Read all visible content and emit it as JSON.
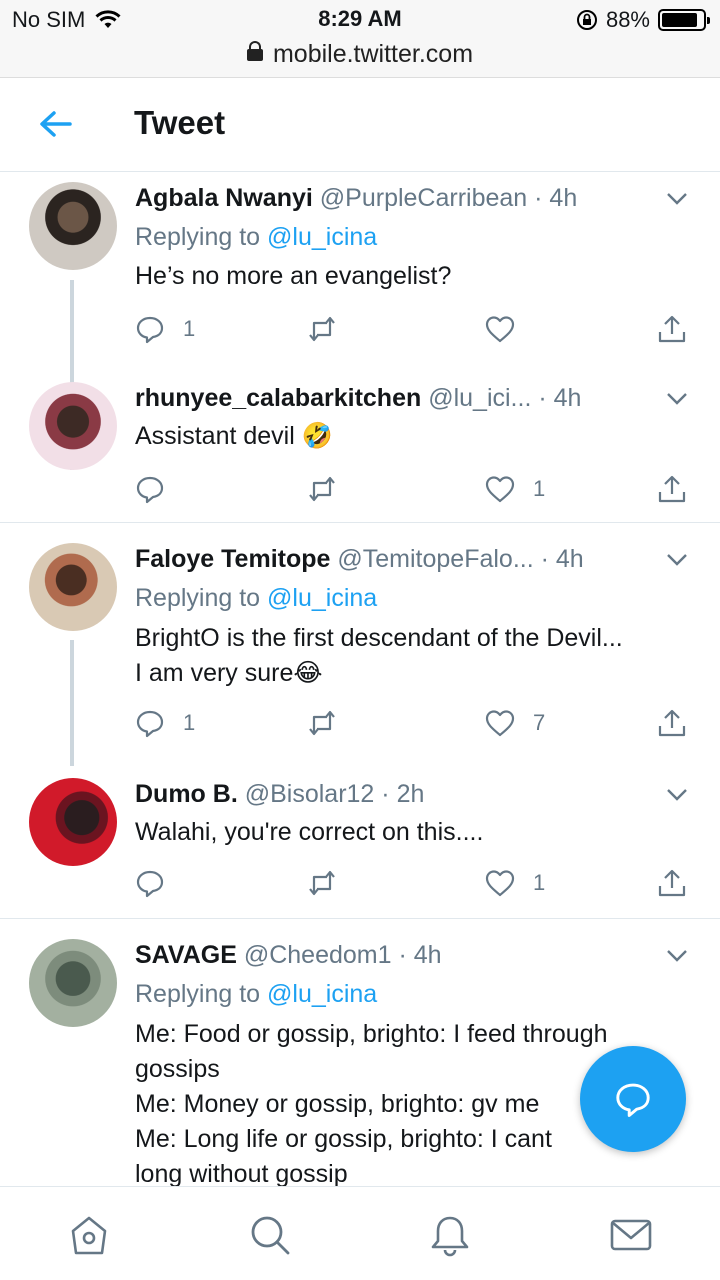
{
  "statusbar": {
    "carrier": "No SIM",
    "time": "8:29 AM",
    "battery": "88%",
    "battery_level": 0.88
  },
  "urlbar": {
    "url": "mobile.twitter.com"
  },
  "header": {
    "title": "Tweet"
  },
  "tweets": [
    {
      "name": "Agbala Nwanyi",
      "handle": "@PurpleCarribean",
      "time": "· 4h",
      "replying_prefix": "Replying to ",
      "replying_to": "@lu_icina",
      "text": [
        "He’s no more an evangelist?"
      ],
      "replies": "1",
      "retweets": "",
      "likes": ""
    },
    {
      "name": "rhunyee_calabarkitchen",
      "handle": "@lu_ici...",
      "time": "· 4h",
      "text": [
        "Assistant devil 🤣"
      ],
      "replies": "",
      "retweets": "",
      "likes": "1"
    },
    {
      "name": "Faloye Temitope",
      "handle": "@TemitopeFalo...",
      "time": "· 4h",
      "replying_prefix": "Replying to ",
      "replying_to": "@lu_icina",
      "text": [
        "BrightO is the first descendant of the Devil...",
        "I am very sure😂"
      ],
      "replies": "1",
      "retweets": "",
      "likes": "7"
    },
    {
      "name": "Dumo B.",
      "handle": "@Bisolar12",
      "time": "· 2h",
      "text": [
        "Walahi, you're correct on this...."
      ],
      "replies": "",
      "retweets": "",
      "likes": "1"
    },
    {
      "name": "SAVAGE",
      "handle": "@Cheedom1",
      "time": "· 4h",
      "replying_prefix": "Replying to ",
      "replying_to": "@lu_icina",
      "text": [
        "Me: Food or gossip, brighto: I feed through",
        "gossips",
        "Me: Money or gossip, brighto: gv me",
        "Me: Long life or gossip, brighto: I cant",
        "long without gossip"
      ],
      "replies": "",
      "retweets": "",
      "likes": ""
    }
  ],
  "icons": {
    "back": "arrow-left-icon",
    "caret": "chevron-down-icon",
    "reply": "reply-icon",
    "retweet": "retweet-icon",
    "like": "heart-icon",
    "share": "share-icon",
    "compose": "compose-icon",
    "home": "home-icon",
    "search": "search-icon",
    "notifications": "bell-icon",
    "messages": "mail-icon"
  },
  "colors": {
    "accent": "#1da1f2",
    "muted": "#657786",
    "text": "#14171a",
    "divider": "#e1e8ed"
  }
}
